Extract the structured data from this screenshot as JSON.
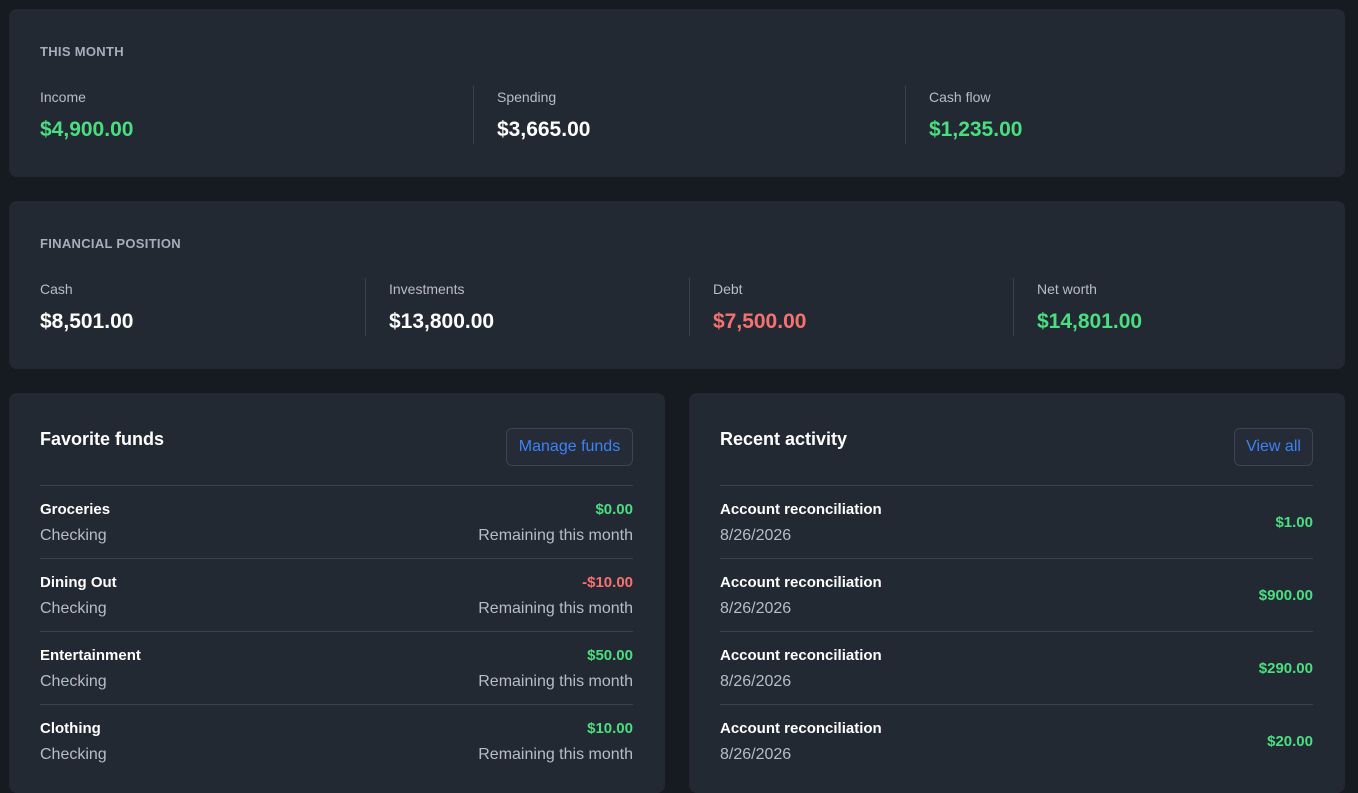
{
  "this_month": {
    "label": "THIS MONTH",
    "stats": [
      {
        "label": "Income",
        "value": "$4,900.00",
        "tone": "green"
      },
      {
        "label": "Spending",
        "value": "$3,665.00",
        "tone": "white"
      },
      {
        "label": "Cash flow",
        "value": "$1,235.00",
        "tone": "green"
      }
    ]
  },
  "financial_position": {
    "label": "FINANCIAL POSITION",
    "stats": [
      {
        "label": "Cash",
        "value": "$8,501.00",
        "tone": "white"
      },
      {
        "label": "Investments",
        "value": "$13,800.00",
        "tone": "white"
      },
      {
        "label": "Debt",
        "value": "$7,500.00",
        "tone": "red"
      },
      {
        "label": "Net worth",
        "value": "$14,801.00",
        "tone": "green"
      }
    ]
  },
  "favorite_funds": {
    "title": "Favorite funds",
    "button_label": "Manage funds",
    "items": [
      {
        "name": "Groceries",
        "account": "Checking",
        "amount": "$0.00",
        "tone": "green",
        "hint": "Remaining this month"
      },
      {
        "name": "Dining Out",
        "account": "Checking",
        "amount": "-$10.00",
        "tone": "red",
        "hint": "Remaining this month"
      },
      {
        "name": "Entertainment",
        "account": "Checking",
        "amount": "$50.00",
        "tone": "green",
        "hint": "Remaining this month"
      },
      {
        "name": "Clothing",
        "account": "Checking",
        "amount": "$10.00",
        "tone": "green",
        "hint": "Remaining this month"
      }
    ]
  },
  "recent_activity": {
    "title": "Recent activity",
    "button_label": "View all",
    "items": [
      {
        "description": "Account reconciliation",
        "date": "8/26/2026",
        "amount": "$1.00",
        "tone": "green"
      },
      {
        "description": "Account reconciliation",
        "date": "8/26/2026",
        "amount": "$900.00",
        "tone": "green"
      },
      {
        "description": "Account reconciliation",
        "date": "8/26/2026",
        "amount": "$290.00",
        "tone": "green"
      },
      {
        "description": "Account reconciliation",
        "date": "8/26/2026",
        "amount": "$20.00",
        "tone": "green"
      }
    ]
  },
  "colors": {
    "background": "#161a21",
    "card": "#232933",
    "positive": "#4ade80",
    "negative": "#f87171",
    "accent": "#3b82f6"
  }
}
